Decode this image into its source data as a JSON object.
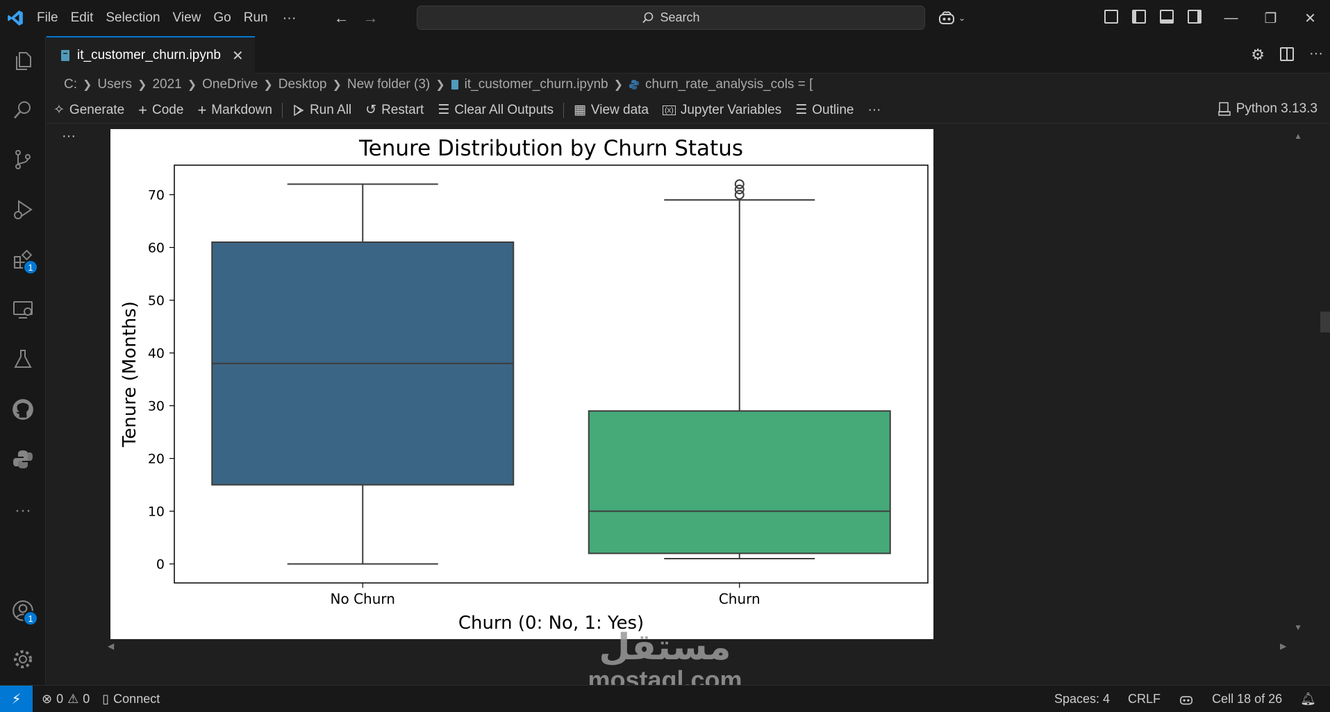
{
  "titlebar": {
    "menu": [
      "File",
      "Edit",
      "Selection",
      "View",
      "Go",
      "Run"
    ],
    "more_glyph": "···",
    "search_placeholder": "Search"
  },
  "tab": {
    "filename": "it_customer_churn.ipynb"
  },
  "breadcrumb": {
    "parts": [
      "C:",
      "Users",
      "2021",
      "OneDrive",
      "Desktop",
      "New folder (3)",
      "it_customer_churn.ipynb",
      "churn_rate_analysis_cols = ["
    ]
  },
  "toolbar": {
    "generate": "Generate",
    "code": "Code",
    "markdown": "Markdown",
    "run_all": "Run All",
    "restart": "Restart",
    "clear_outputs": "Clear All Outputs",
    "view_data": "View data",
    "jupyter_variables": "Jupyter Variables",
    "outline": "Outline",
    "more": "···",
    "kernel": "Python 3.13.3"
  },
  "activity": {
    "extensions_badge": "1",
    "accounts_badge": "1",
    "more": "···"
  },
  "cell": {
    "dots": "···"
  },
  "chart_data": {
    "type": "box",
    "title": "Tenure Distribution by Churn Status",
    "xlabel": "Churn (0: No, 1: Yes)",
    "ylabel": "Tenure (Months)",
    "categories": [
      "No Churn",
      "Churn"
    ],
    "ylim": [
      -3.6,
      75.6
    ],
    "yticks": [
      0,
      10,
      20,
      30,
      40,
      50,
      60,
      70
    ],
    "grid": false,
    "boxes": [
      {
        "category": "No Churn",
        "whisker_low": 0,
        "q1": 15,
        "median": 38,
        "q3": 61,
        "whisker_high": 72,
        "outliers": [],
        "color": "#3b6584"
      },
      {
        "category": "Churn",
        "whisker_low": 1,
        "q1": 2,
        "median": 10,
        "q3": 29,
        "whisker_high": 69,
        "outliers": [
          70,
          71,
          72
        ],
        "color": "#45a978"
      }
    ]
  },
  "statusbar": {
    "errors": "0",
    "warnings": "0",
    "connect": "Connect",
    "spaces": "Spaces: 4",
    "eol": "CRLF",
    "cell_position": "Cell 18 of 26"
  },
  "watermark": {
    "arabic": "مستقل",
    "latin": "mostaql.com"
  }
}
